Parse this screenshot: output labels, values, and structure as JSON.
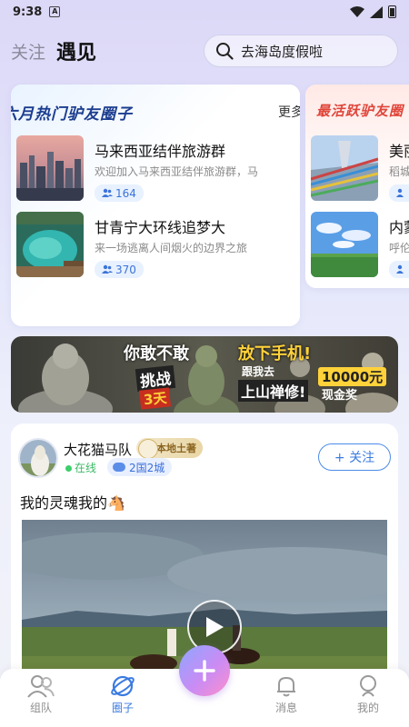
{
  "status_bar": {
    "time": "9:38",
    "notification_icon": "A"
  },
  "header": {
    "tab_follow": "关注",
    "tab_meet": "遇见",
    "search_placeholder": "去海岛度假啦"
  },
  "hot_groups": {
    "title": "六月热门驴友圈子",
    "more": "更多",
    "items": [
      {
        "name": "马来西亚结伴旅游群",
        "desc": "欢迎加入马来西亚结伴旅游群，马",
        "count": "164"
      },
      {
        "name": "甘青宁大环线追梦大",
        "desc": "来一场逃离人间烟火的边界之旅",
        "count": "370"
      }
    ]
  },
  "active_groups": {
    "title": "最活跃驴友圈",
    "items": [
      {
        "name": "美丽",
        "desc": "稻城"
      },
      {
        "name": "内蒙",
        "desc": "呼伦"
      }
    ]
  },
  "banner": {
    "title": "你敢不敢",
    "title2": "放下手机!",
    "challenge": "挑战",
    "days": "3天",
    "follow": "跟我去",
    "mountain": "上山禅修!",
    "prize": "10000元",
    "cash": "现金奖"
  },
  "post": {
    "username": "大花猫马队",
    "badge": "本地土著",
    "status": "在线",
    "countries": "2国2城",
    "follow_label": "+ 关注",
    "text": "我的灵魂我的🐴"
  },
  "bottom_nav": {
    "items": [
      {
        "label": "组队"
      },
      {
        "label": "圈子"
      },
      {
        "label": "消息"
      },
      {
        "label": "我的"
      }
    ]
  },
  "colors": {
    "accent": "#3b7be0",
    "hot_title": "#1b3d8f",
    "active_title": "#e0453a",
    "online": "#3bb866"
  }
}
